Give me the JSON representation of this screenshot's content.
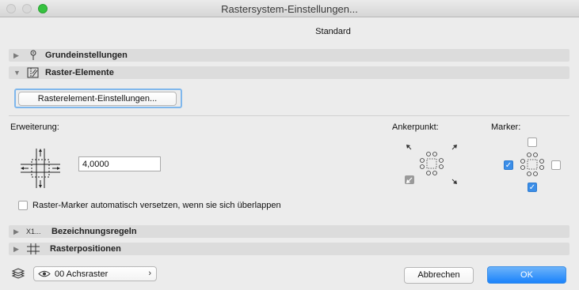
{
  "window": {
    "title": "Rastersystem-Einstellungen..."
  },
  "header": {
    "subtitle": "Standard"
  },
  "sections": {
    "grundeinstellungen": {
      "label": "Grundeinstellungen"
    },
    "raster_elemente": {
      "label": "Raster-Elemente"
    },
    "bezeichnungsregeln": {
      "label": "Bezeichnungsregeln"
    },
    "rasterpositionen": {
      "label": "Rasterpositionen"
    }
  },
  "raster_elemente": {
    "settings_button": "Rasterelement-Einstellungen...",
    "erweiterung_label": "Erweiterung:",
    "erweiterung_value": "4,0000",
    "ankerpunkt_label": "Ankerpunkt:",
    "marker_label": "Marker:",
    "auto_offset_label": "Raster-Marker automatisch versetzen, wenn sie sich überlappen",
    "auto_offset_checked": false,
    "marker_checks": {
      "top": false,
      "left": true,
      "right": false,
      "bottom": true
    }
  },
  "footer": {
    "layer_value": "00 Achsraster",
    "cancel_label": "Abbrechen",
    "ok_label": "OK"
  },
  "colors": {
    "accent": "#1a82fb",
    "checkbox_checked": "#3b8ee8",
    "focus_ring": "#7fb7ec"
  }
}
